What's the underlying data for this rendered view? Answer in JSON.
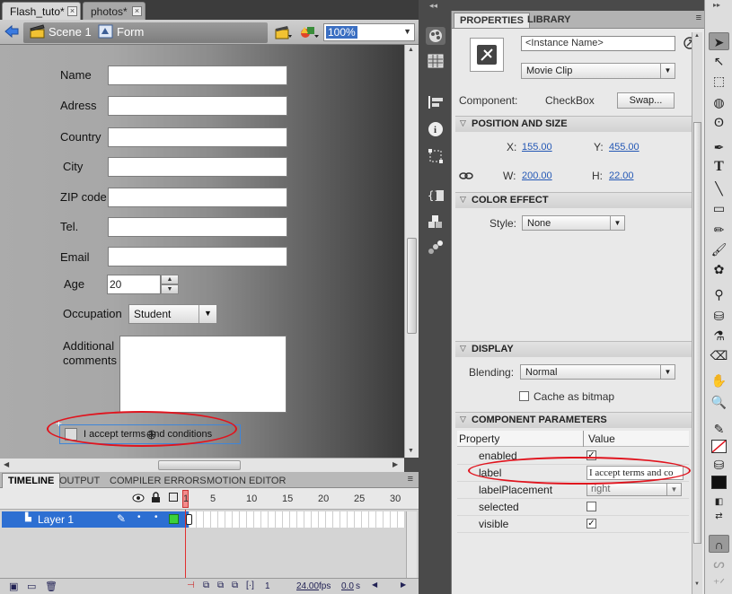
{
  "doc_tabs": [
    {
      "label": "Flash_tuto*",
      "close": "×"
    },
    {
      "label": "photos*",
      "close": "×"
    }
  ],
  "edit_bar": {
    "scene": "Scene 1",
    "symbol": "Form",
    "zoom": "100%"
  },
  "form": {
    "name_label": "Name",
    "address_label": "Adress",
    "country_label": "Country",
    "city_label": "City",
    "zip_label": "ZIP code",
    "tel_label": "Tel.",
    "email_label": "Email",
    "age_label": "Age",
    "age_value": "20",
    "occupation_label": "Occupation",
    "occupation_value": "Student",
    "comments_label_1": "Additional",
    "comments_label_2": "comments",
    "terms_checkbox_label": "I accept terms and conditions"
  },
  "timeline": {
    "tabs": [
      "TIMELINE",
      "OUTPUT",
      "COMPILER ERRORS",
      "MOTION EDITOR"
    ],
    "frame_numbers": [
      "1",
      "5",
      "10",
      "15",
      "20",
      "25",
      "30"
    ],
    "layer_name": "Layer 1",
    "current_frame": "1",
    "fps_value": "24.00",
    "fps_unit": "fps",
    "time_value": "0.0",
    "time_unit": "s"
  },
  "properties": {
    "tabs": [
      "PROPERTIES",
      "LIBRARY"
    ],
    "instance_name_placeholder": "<Instance Name>",
    "symbol_type": "Movie Clip",
    "component_label": "Component:",
    "component_value": "CheckBox",
    "swap_label": "Swap...",
    "position_section": "POSITION AND SIZE",
    "x_label": "X:",
    "x_value": "155.00",
    "y_label": "Y:",
    "y_value": "455.00",
    "w_label": "W:",
    "w_value": "200.00",
    "h_label": "H:",
    "h_value": "22.00",
    "color_section": "COLOR EFFECT",
    "style_label": "Style:",
    "style_value": "None",
    "display_section": "DISPLAY",
    "blending_label": "Blending:",
    "blending_value": "Normal",
    "cache_label": "Cache as bitmap",
    "params_section": "COMPONENT PARAMETERS",
    "col_property": "Property",
    "col_value": "Value",
    "params": [
      {
        "name": "enabled",
        "type": "checkbox",
        "checked": true
      },
      {
        "name": "label",
        "type": "text",
        "value": "I accept terms and co"
      },
      {
        "name": "labelPlacement",
        "type": "select",
        "value": "right"
      },
      {
        "name": "selected",
        "type": "checkbox",
        "checked": false
      },
      {
        "name": "visible",
        "type": "checkbox",
        "checked": true
      }
    ]
  },
  "colors": {
    "accent": "#2d6fd2",
    "highlight": "#e0141e"
  }
}
